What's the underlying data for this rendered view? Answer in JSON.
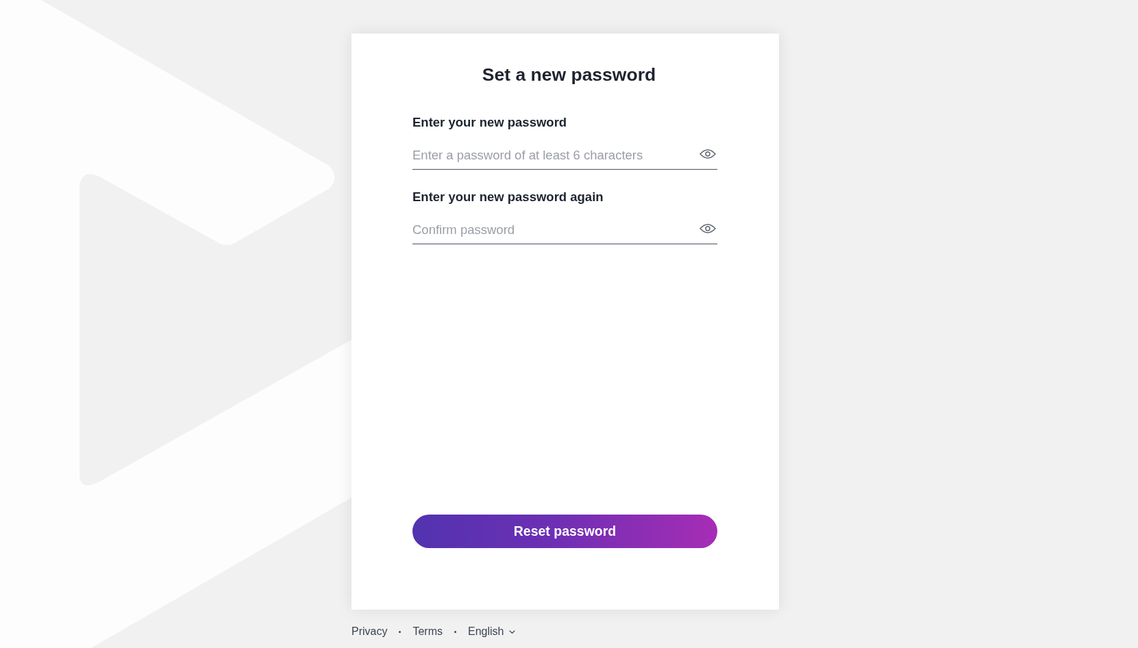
{
  "card": {
    "title": "Set a new password",
    "fields": [
      {
        "label": "Enter your new password",
        "placeholder": "Enter a password of at least 6 characters"
      },
      {
        "label": "Enter your new password again",
        "placeholder": "Confirm password"
      }
    ],
    "submit_button": {
      "label": "Reset password"
    }
  },
  "footer": {
    "links": [
      {
        "label": "Privacy"
      },
      {
        "label": "Terms"
      }
    ],
    "language": {
      "label": "English"
    }
  }
}
